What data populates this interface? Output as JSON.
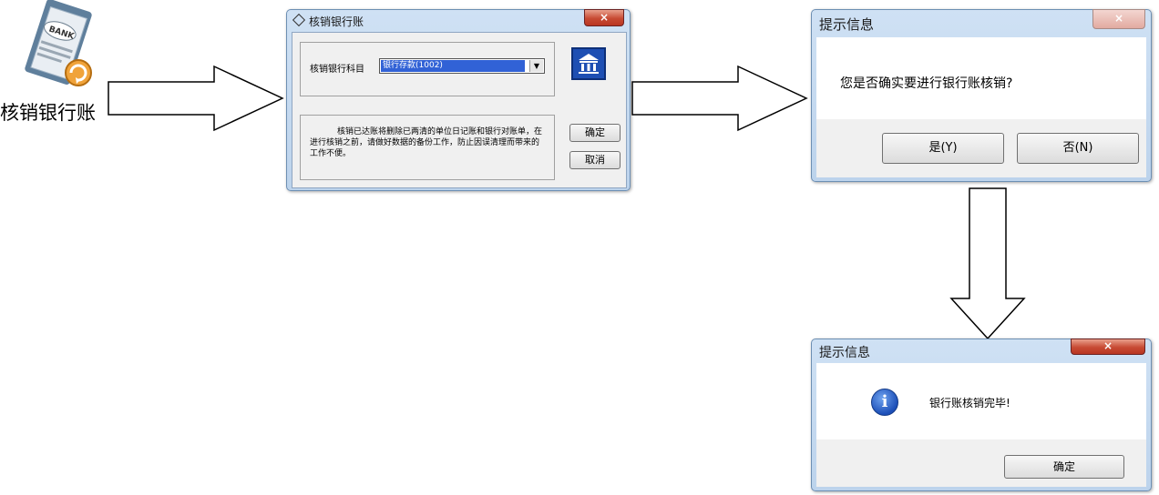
{
  "desktop_icon": {
    "label": "核销银行账",
    "image_text": "BANK"
  },
  "dialog_main": {
    "title": "核销银行账",
    "subject_label": "核销银行科目",
    "subject_value": "银行存款(1002)",
    "notice": "核销已达账将删除已两清的单位日记账和银行对账单，在进行核销之前，请做好数据的备份工作，防止因误清理而带来的工作不便。",
    "ok_label": "确定",
    "cancel_label": "取消",
    "close_glyph": "×"
  },
  "dialog_confirm": {
    "title": "提示信息",
    "message": "您是否确实要进行银行账核销?",
    "yes_label": "是(Y)",
    "no_label": "否(N)",
    "close_glyph": "×"
  },
  "dialog_done": {
    "title": "提示信息",
    "message": "银行账核销完毕!",
    "info_glyph": "i",
    "ok_label": "确定",
    "close_glyph": "×"
  }
}
